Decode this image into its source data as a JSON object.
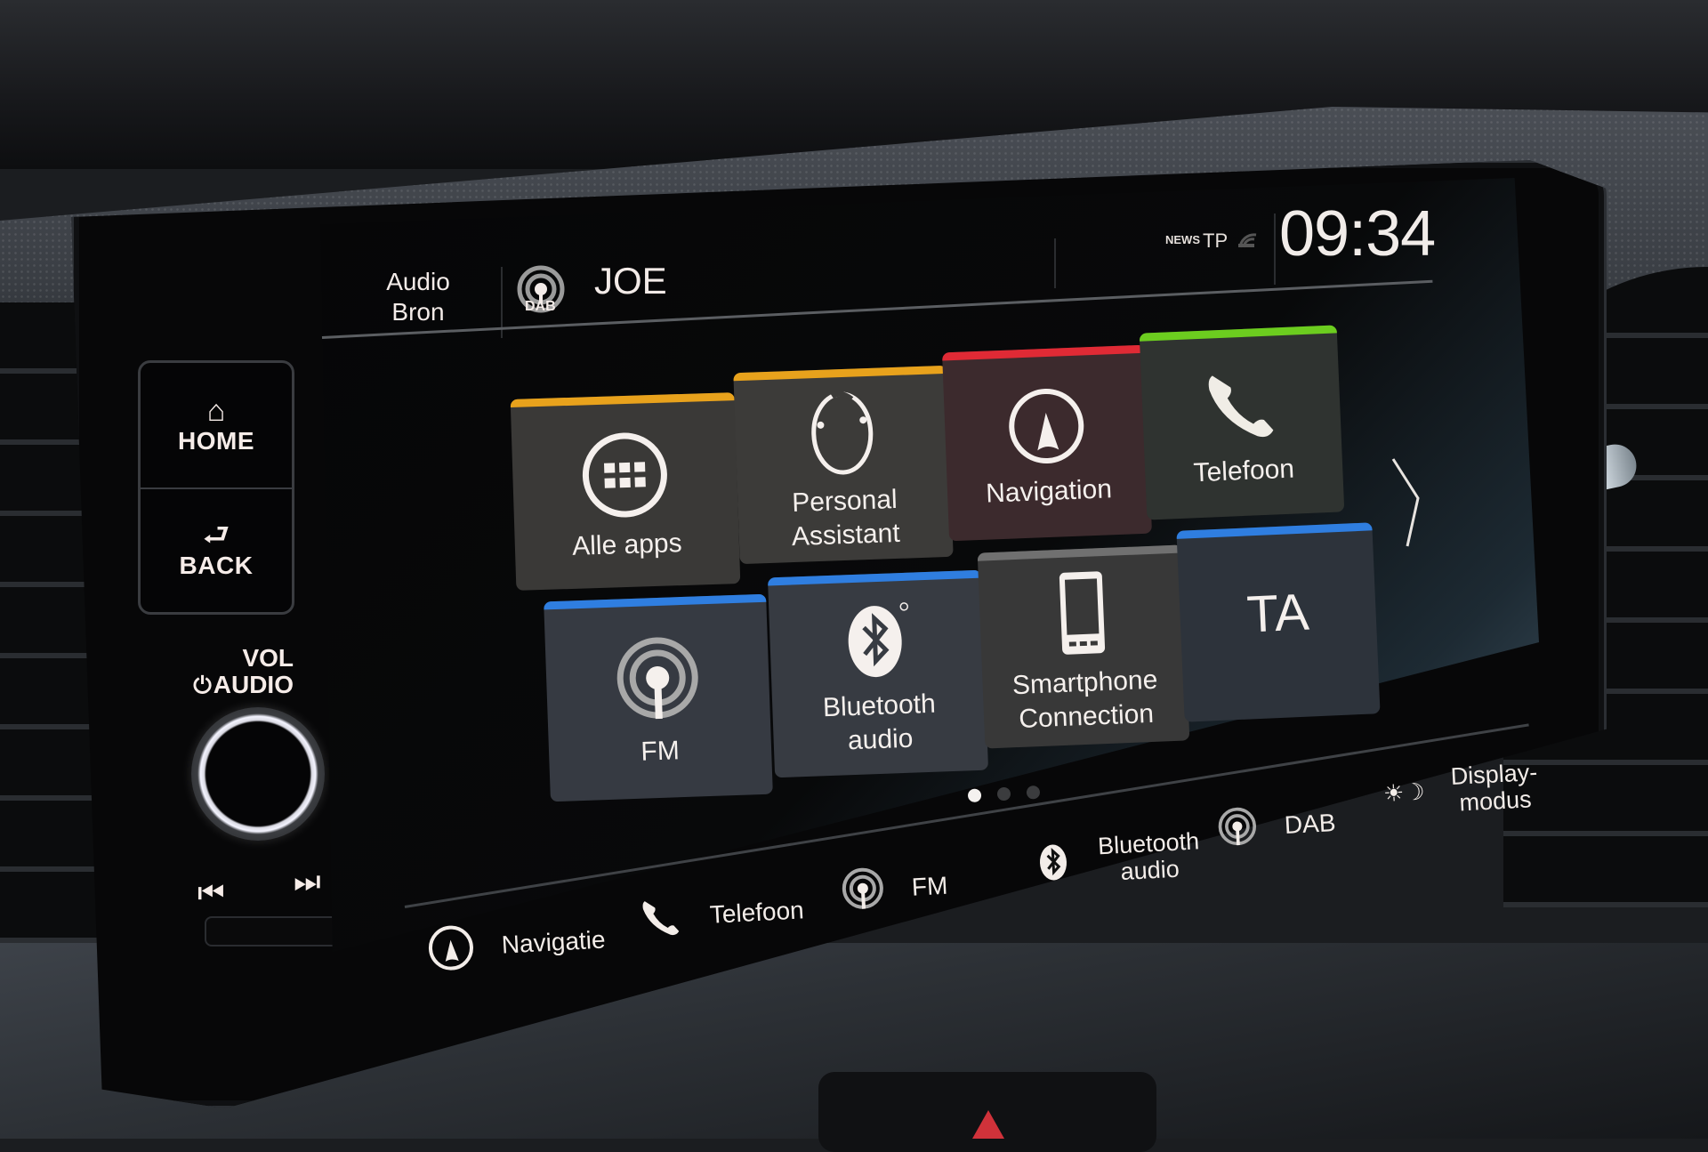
{
  "header": {
    "audio_source_label_line1": "Audio",
    "audio_source_label_line2": "Bron",
    "source_badge": "DAB",
    "station": "JOE",
    "status_news": "NEWS",
    "status_tp": "TP",
    "clock": "09:34"
  },
  "hardware": {
    "home_label": "HOME",
    "back_label": "BACK",
    "vol_label_line1": "VOL",
    "vol_label_line2": "AUDIO"
  },
  "tiles": [
    {
      "label": "Alle apps",
      "icon": "apps-grid-icon",
      "accent": "#e8a21c"
    },
    {
      "label_line1": "Personal",
      "label_line2": "Assistant",
      "icon": "assistant-icon",
      "accent": "#e8a21c"
    },
    {
      "label": "Navigation",
      "icon": "navigation-icon",
      "accent": "#e02a35"
    },
    {
      "label": "Telefoon",
      "icon": "phone-icon",
      "accent": "#6ccd1f"
    },
    {
      "label": "FM",
      "icon": "radio-icon",
      "accent": "#2f7ee0"
    },
    {
      "label_line1": "Bluetooth",
      "label_line2": "audio",
      "icon": "bluetooth-icon",
      "accent": "#2f7ee0"
    },
    {
      "label_line1": "Smartphone",
      "label_line2": "Connection",
      "icon": "smartphone-icon",
      "accent": "#707070"
    },
    {
      "label": "TA",
      "icon": "ta-text-icon",
      "accent": "#2f7ee0"
    }
  ],
  "pagination": {
    "current": 1,
    "total": 3
  },
  "shortcuts": [
    {
      "label": "Navigatie",
      "icon": "navigation-icon"
    },
    {
      "label": "Telefoon",
      "icon": "phone-icon"
    },
    {
      "label": "FM",
      "icon": "radio-icon"
    },
    {
      "label_line1": "Bluetooth",
      "label_line2": "audio",
      "icon": "bluetooth-icon"
    },
    {
      "label": "DAB",
      "icon": "radio-icon"
    },
    {
      "label_line1": "Display-",
      "label_line2": "modus",
      "icon": "day-night-icon"
    }
  ]
}
